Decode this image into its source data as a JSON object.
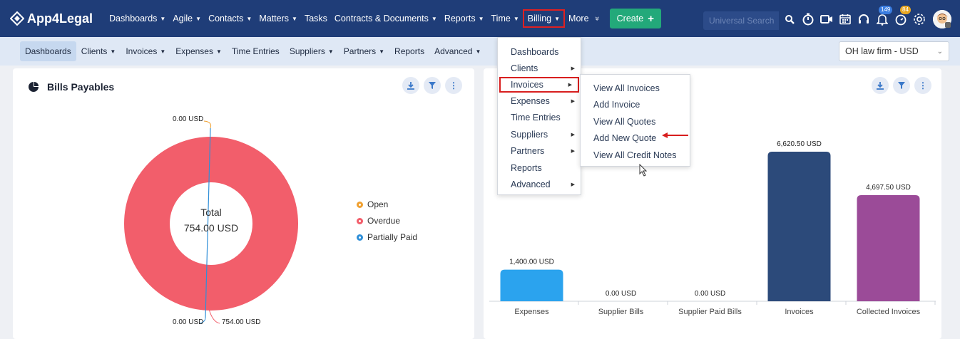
{
  "app": {
    "name": "App4Legal"
  },
  "topnav": {
    "items": [
      {
        "label": "Dashboards",
        "caret": true
      },
      {
        "label": "Agile",
        "caret": true
      },
      {
        "label": "Contacts",
        "caret": true
      },
      {
        "label": "Matters",
        "caret": true
      },
      {
        "label": "Tasks",
        "caret": false
      },
      {
        "label": "Contracts & Documents",
        "caret": true
      },
      {
        "label": "Reports",
        "caret": true
      },
      {
        "label": "Time",
        "caret": true
      },
      {
        "label": "Billing",
        "caret": true
      },
      {
        "label": "More",
        "caret": false
      }
    ],
    "more_chevron": "»",
    "create_label": "Create",
    "search_placeholder": "Universal Search",
    "icons": [
      "search-icon",
      "timer-icon",
      "video-icon",
      "calendar-icon",
      "headset-icon",
      "notification-icon",
      "reminder-icon",
      "settings-icon",
      "avatar"
    ],
    "badges": {
      "notifications": "149",
      "reminders": "84"
    }
  },
  "subnav": {
    "items": [
      {
        "label": "Dashboards",
        "caret": false
      },
      {
        "label": "Clients",
        "caret": true
      },
      {
        "label": "Invoices",
        "caret": true
      },
      {
        "label": "Expenses",
        "caret": true
      },
      {
        "label": "Time Entries",
        "caret": false
      },
      {
        "label": "Suppliers",
        "caret": true
      },
      {
        "label": "Partners",
        "caret": true
      },
      {
        "label": "Reports",
        "caret": false
      },
      {
        "label": "Advanced",
        "caret": true
      }
    ],
    "firm_select": "OH law firm - USD"
  },
  "billing_menu": {
    "items": [
      {
        "label": "Dashboards",
        "submenu": false
      },
      {
        "label": "Clients",
        "submenu": true
      },
      {
        "label": "Invoices",
        "submenu": true
      },
      {
        "label": "Expenses",
        "submenu": true
      },
      {
        "label": "Time Entries",
        "submenu": false
      },
      {
        "label": "Suppliers",
        "submenu": true
      },
      {
        "label": "Partners",
        "submenu": true
      },
      {
        "label": "Reports",
        "submenu": false
      },
      {
        "label": "Advanced",
        "submenu": true
      }
    ]
  },
  "invoices_submenu": {
    "items": [
      "View All Invoices",
      "Add Invoice",
      "View All Quotes",
      "Add New Quote",
      "View All Credit Notes"
    ]
  },
  "card1": {
    "title": "Bills Payables",
    "center_label": "Total",
    "center_value": "754.00 USD",
    "labels": {
      "open": "0.00 USD",
      "partially_paid": "0.00 USD",
      "overdue": "754.00 USD"
    },
    "legend": [
      {
        "name": "Open",
        "color": "#f0a030"
      },
      {
        "name": "Overdue",
        "color": "#f25e6b"
      },
      {
        "name": "Partially Paid",
        "color": "#2f8fd8"
      }
    ]
  },
  "chart_data": [
    {
      "type": "pie",
      "title": "Bills Payables",
      "series": [
        {
          "name": "Open",
          "value": 0
        },
        {
          "name": "Overdue",
          "value": 754
        },
        {
          "name": "Partially Paid",
          "value": 0
        }
      ],
      "total": "754.00 USD",
      "legend": "right"
    },
    {
      "type": "bar",
      "categories": [
        "Expenses",
        "Supplier Bills",
        "Supplier Paid Bills",
        "Invoices",
        "Collected Invoices"
      ],
      "values": [
        1400,
        0,
        0,
        6620.5,
        4697.5
      ],
      "data_labels": [
        "1,400.00 USD",
        "0.00 USD",
        "0.00 USD",
        "6,620.50 USD",
        "4,697.50 USD"
      ],
      "colors": [
        "#2ba3ee",
        "#2ba3ee",
        "#2ba3ee",
        "#2c4a7a",
        "#9b4b98"
      ],
      "ylim": [
        0,
        7000
      ]
    }
  ]
}
